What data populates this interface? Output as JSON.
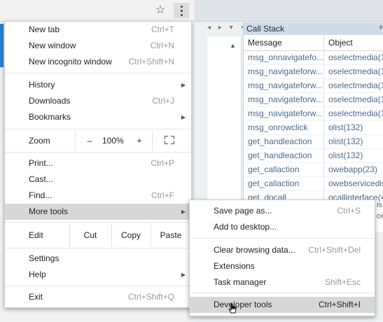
{
  "toolbar": {
    "star_icon": "star-icon",
    "star_glyph": "☆",
    "menu_icon": "kebab-menu-icon"
  },
  "ide": {
    "tab_controls": "◂ ▸ ▾ ×",
    "scroll_up": "▲",
    "callstack": {
      "title": "Call Stack",
      "pin": "ᵖ",
      "columns": [
        "Message",
        "Object"
      ],
      "rows": [
        [
          "msg_onnavigatefo...",
          "oselectmedia(1"
        ],
        [
          "msg_navigateforw...",
          "oselectmedia(1"
        ],
        [
          "msg_navigateforw...",
          "oselectmedia(1"
        ],
        [
          "msg_navigateforw...",
          "oselectmedia(1"
        ],
        [
          "msg_navigateforw...",
          "oselectmedia(1"
        ],
        [
          "msg_onrowclick",
          "olist(132)"
        ],
        [
          "get_handleaction",
          "olist(132)"
        ],
        [
          "get_handleaction",
          "olist(132)"
        ],
        [
          "get_callaction",
          "owebapp(23)"
        ],
        [
          "get_callaction",
          "owebservicedis"
        ],
        [
          "get_docall",
          "ocallinterface(4"
        ]
      ],
      "overflow_1": "is",
      "overflow_2": "on"
    }
  },
  "menu": {
    "new_tab": {
      "label": "New tab",
      "shortcut": "Ctrl+T"
    },
    "new_window": {
      "label": "New window",
      "shortcut": "Ctrl+N"
    },
    "new_incognito": {
      "label": "New incognito window",
      "shortcut": "Ctrl+Shift+N"
    },
    "history": {
      "label": "History",
      "arrow": "▶"
    },
    "downloads": {
      "label": "Downloads",
      "shortcut": "Ctrl+J"
    },
    "bookmarks": {
      "label": "Bookmarks",
      "arrow": "▶"
    },
    "zoom": {
      "label": "Zoom",
      "minus": "–",
      "value": "100%",
      "plus": "+"
    },
    "print": {
      "label": "Print...",
      "shortcut": "Ctrl+P"
    },
    "cast": {
      "label": "Cast..."
    },
    "find": {
      "label": "Find...",
      "shortcut": "Ctrl+F"
    },
    "more_tools": {
      "label": "More tools",
      "arrow": "▶"
    },
    "edit": {
      "label": "Edit",
      "cut": "Cut",
      "copy": "Copy",
      "paste": "Paste"
    },
    "settings": {
      "label": "Settings"
    },
    "help": {
      "label": "Help",
      "arrow": "▶"
    },
    "exit": {
      "label": "Exit",
      "shortcut": "Ctrl+Shift+Q"
    }
  },
  "submenu": {
    "save_page": {
      "label": "Save page as...",
      "shortcut": "Ctrl+S"
    },
    "add_desktop": {
      "label": "Add to desktop..."
    },
    "clear_data": {
      "label": "Clear browsing data...",
      "shortcut": "Ctrl+Shift+Del"
    },
    "extensions": {
      "label": "Extensions"
    },
    "task_manager": {
      "label": "Task manager",
      "shortcut": "Shift+Esc"
    },
    "dev_tools": {
      "label": "Developer tools",
      "shortcut": "Ctrl+Shift+I"
    }
  }
}
